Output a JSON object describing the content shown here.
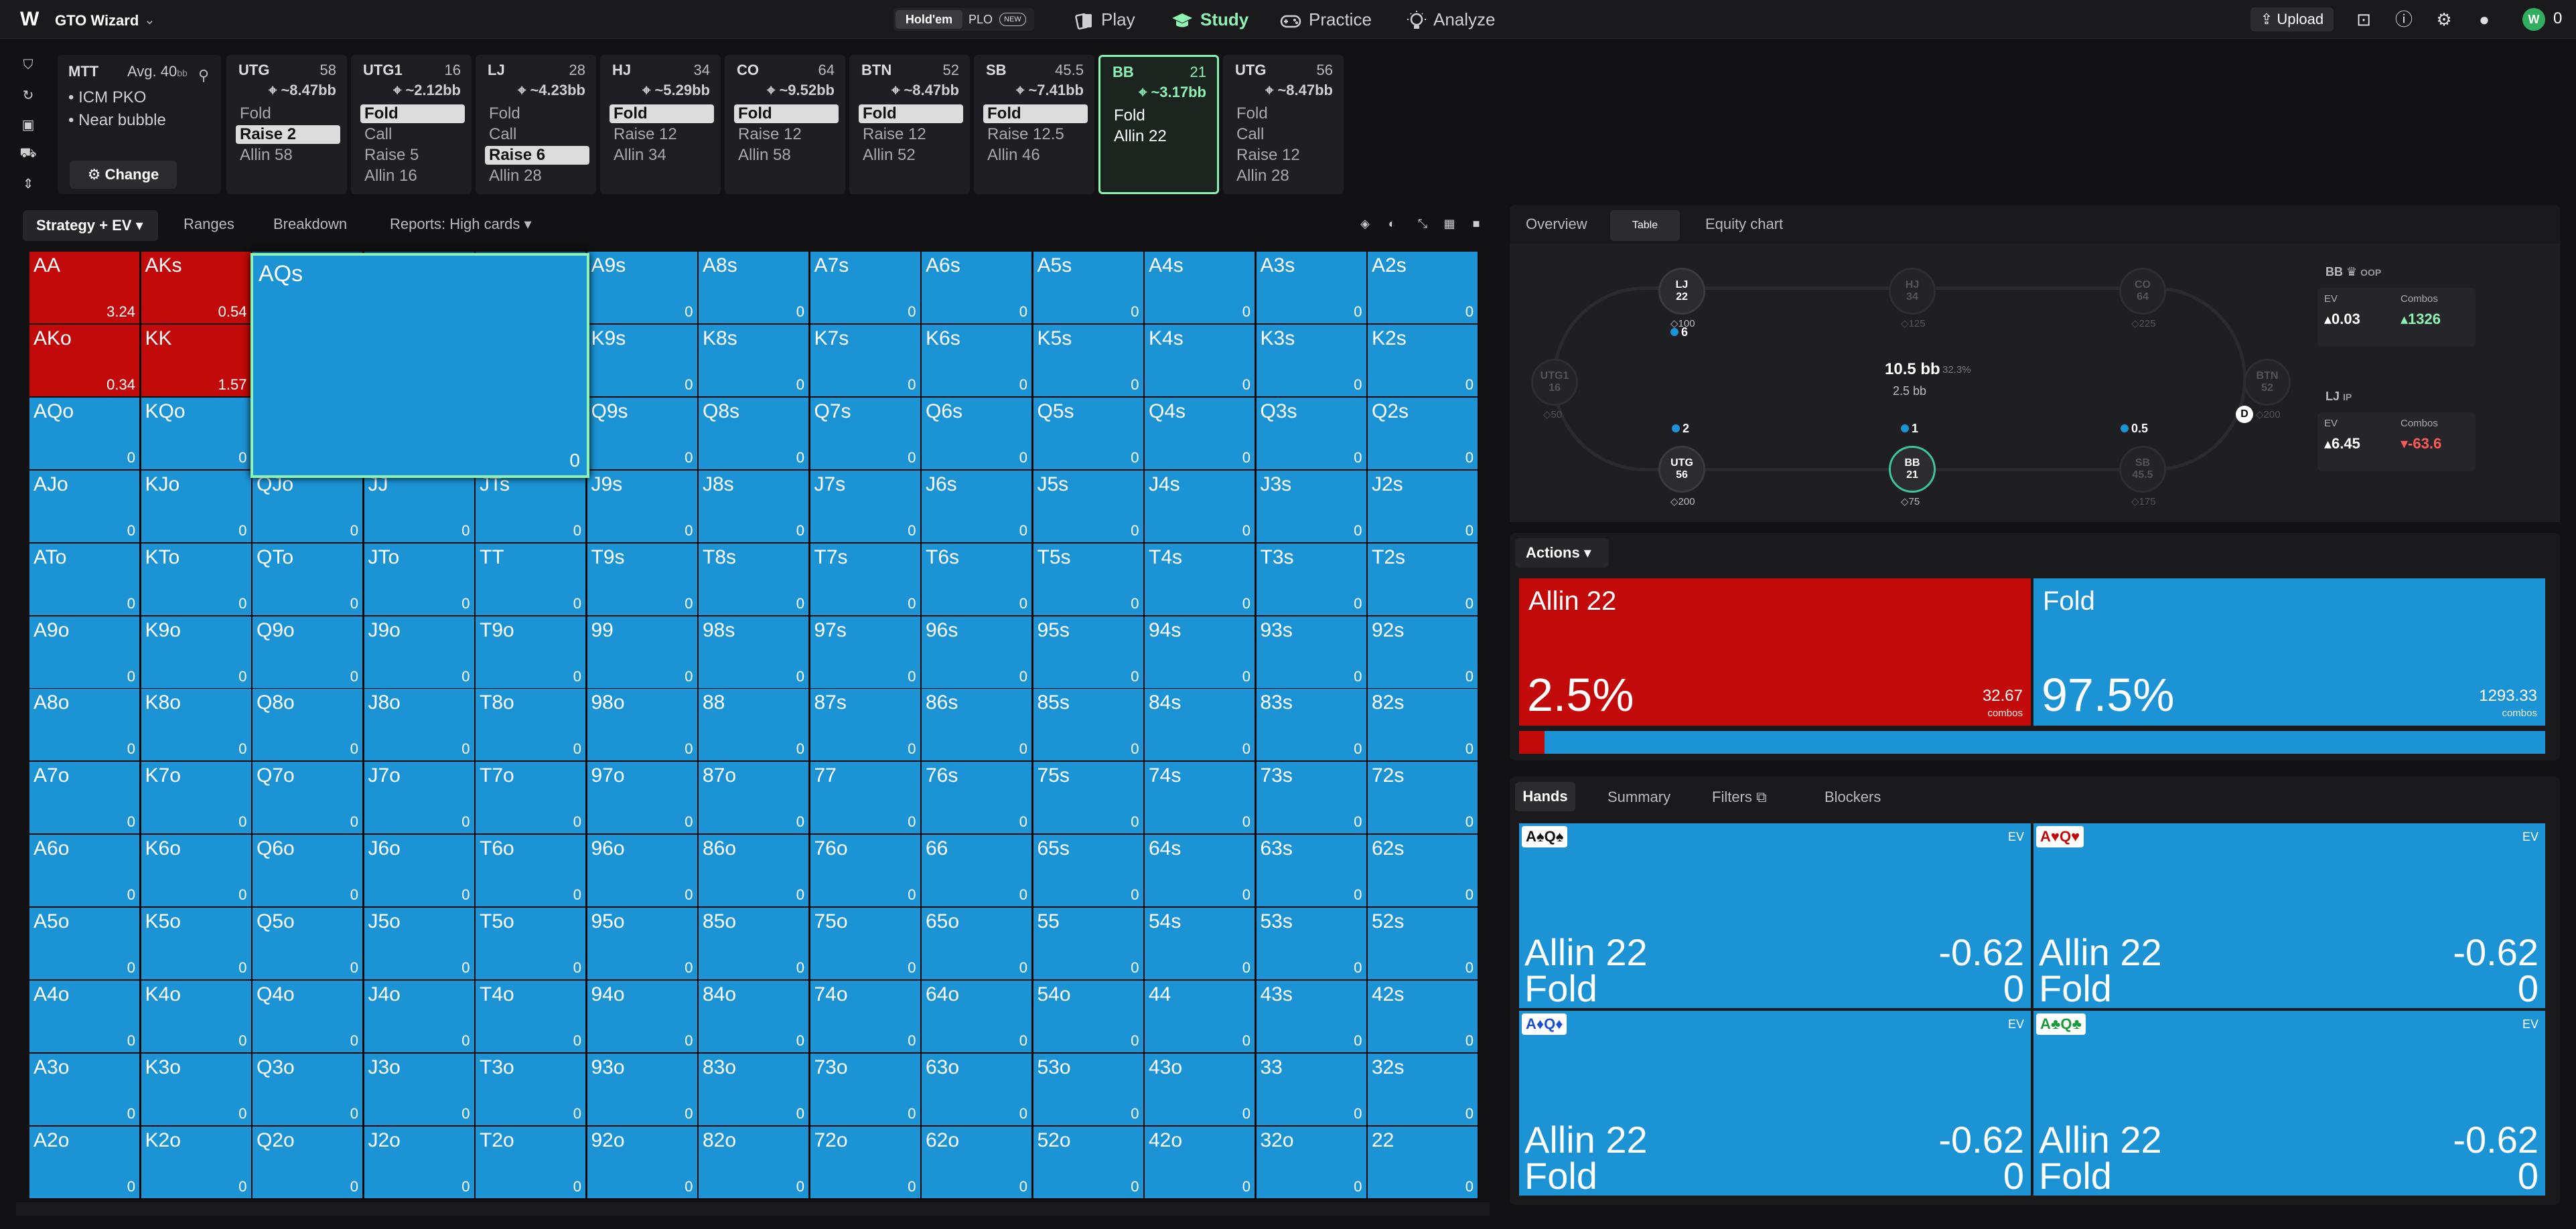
{
  "app": {
    "title": "GTO Wizard",
    "logo": "W"
  },
  "gametype": {
    "holdem": "Hold'em",
    "plo": "PLO",
    "plo_badge": "NEW"
  },
  "nav": {
    "play": "Play",
    "study": "Study",
    "practice": "Practice",
    "analyze": "Analyze"
  },
  "toolbar": {
    "upload": "Upload",
    "coins": "0"
  },
  "settings": {
    "format": "MTT",
    "avg": "Avg. 40",
    "avg_unit": "bb",
    "icm": "ICM PKO",
    "bubble": "Near bubble",
    "change": "Change"
  },
  "positions": [
    {
      "name": "UTG",
      "stack": "58",
      "pot": "~8.47bb",
      "actions": [
        "Fold",
        "Raise 2",
        "Allin 58"
      ],
      "selected": 1
    },
    {
      "name": "UTG1",
      "stack": "16",
      "pot": "~2.12bb",
      "actions": [
        "Fold",
        "Call",
        "Raise 5",
        "Allin 16"
      ],
      "selected": 0
    },
    {
      "name": "LJ",
      "stack": "28",
      "pot": "~4.23bb",
      "actions": [
        "Fold",
        "Call",
        "Raise 6",
        "Allin 28"
      ],
      "selected": 2
    },
    {
      "name": "HJ",
      "stack": "34",
      "pot": "~5.29bb",
      "actions": [
        "Fold",
        "Raise 12",
        "Allin 34"
      ],
      "selected": 0
    },
    {
      "name": "CO",
      "stack": "64",
      "pot": "~9.52bb",
      "actions": [
        "Fold",
        "Raise 12",
        "Allin 58"
      ],
      "selected": 0
    },
    {
      "name": "BTN",
      "stack": "52",
      "pot": "~8.47bb",
      "actions": [
        "Fold",
        "Raise 12",
        "Allin 52"
      ],
      "selected": 0
    },
    {
      "name": "SB",
      "stack": "45.5",
      "pot": "~7.41bb",
      "actions": [
        "Fold",
        "Raise 12.5",
        "Allin 46"
      ],
      "selected": 0
    },
    {
      "name": "BB",
      "stack": "21",
      "pot": "~3.17bb",
      "actions": [
        "Fold",
        "Allin 22"
      ],
      "selected": -1
    },
    {
      "name": "UTG",
      "stack": "56",
      "pot": "~8.47bb",
      "actions": [
        "Fold",
        "Call",
        "Raise 12",
        "Allin 28"
      ],
      "selected": -1
    }
  ],
  "subtabs": {
    "strategy": "Strategy + EV",
    "ranges": "Ranges",
    "breakdown": "Breakdown",
    "reports": "Reports: High cards"
  },
  "grid": {
    "ranks": [
      "A",
      "K",
      "Q",
      "J",
      "T",
      "9",
      "8",
      "7",
      "6",
      "5",
      "4",
      "3",
      "2"
    ],
    "red_hands": {
      "AA": "3.24",
      "AKs": "0.54",
      "AKo": "0.34",
      "KK": "1.57"
    },
    "default_value": "0",
    "selected_hand": "AQs",
    "selected_value": "0"
  },
  "right_tabs": {
    "overview": "Overview",
    "table": "Table",
    "equity": "Equity chart"
  },
  "table": {
    "pot": "10.5 bb",
    "pot_pct": "32.3%",
    "pot_sub": "2.5 bb",
    "seats": [
      {
        "name": "LJ",
        "stack": "22",
        "chips": "100",
        "dim": false
      },
      {
        "name": "HJ",
        "stack": "34",
        "chips": "125",
        "dim": true
      },
      {
        "name": "CO",
        "stack": "64",
        "chips": "225",
        "dim": true
      },
      {
        "name": "UTG1",
        "stack": "16",
        "chips": "50",
        "dim": true
      },
      {
        "name": "BTN",
        "stack": "52",
        "chips": "200",
        "dim": true
      },
      {
        "name": "UTG",
        "stack": "56",
        "chips": "200",
        "dim": false
      },
      {
        "name": "BB",
        "stack": "21",
        "chips": "75",
        "dim": false
      },
      {
        "name": "SB",
        "stack": "45.5",
        "chips": "175",
        "dim": true
      }
    ],
    "bets": {
      "lj": "6",
      "utg": "2",
      "bb": "1",
      "sb": "0.5"
    },
    "oop": {
      "label": "BB",
      "tag": "OOP",
      "ev_label": "EV",
      "ev": "0.03",
      "combos_label": "Combos",
      "combos": "1326"
    },
    "ip": {
      "label": "LJ",
      "tag": "IP",
      "ev_label": "EV",
      "ev": "6.45",
      "combos_label": "Combos",
      "combos": "-63.6"
    }
  },
  "actions": {
    "title": "Actions",
    "allin": {
      "name": "Allin 22",
      "pct": "2.5%",
      "combos": "32.67",
      "combos_label": "combos",
      "color": "#c20a0a"
    },
    "fold": {
      "name": "Fold",
      "pct": "97.5%",
      "combos": "1293.33",
      "combos_label": "combos",
      "color": "#1b93d5"
    }
  },
  "hands_tabs": {
    "hands": "Hands",
    "summary": "Summary",
    "filters": "Filters",
    "blockers": "Blockers"
  },
  "hand_cards": [
    {
      "combo": "A♠Q♠",
      "color": "#111",
      "ev": "EV",
      "a1": "Allin 22",
      "v1": "-0.62",
      "a2": "Fold",
      "v2": "0"
    },
    {
      "combo": "A♥Q♥",
      "color": "#c20a0a",
      "ev": "EV",
      "a1": "Allin 22",
      "v1": "-0.62",
      "a2": "Fold",
      "v2": "0"
    },
    {
      "combo": "A♦Q♦",
      "color": "#1a4fd6",
      "ev": "EV",
      "a1": "Allin 22",
      "v1": "-0.62",
      "a2": "Fold",
      "v2": "0"
    },
    {
      "combo": "A♣Q♣",
      "color": "#1a9a3a",
      "ev": "EV",
      "a1": "Allin 22",
      "v1": "-0.62",
      "a2": "Fold",
      "v2": "0"
    }
  ]
}
